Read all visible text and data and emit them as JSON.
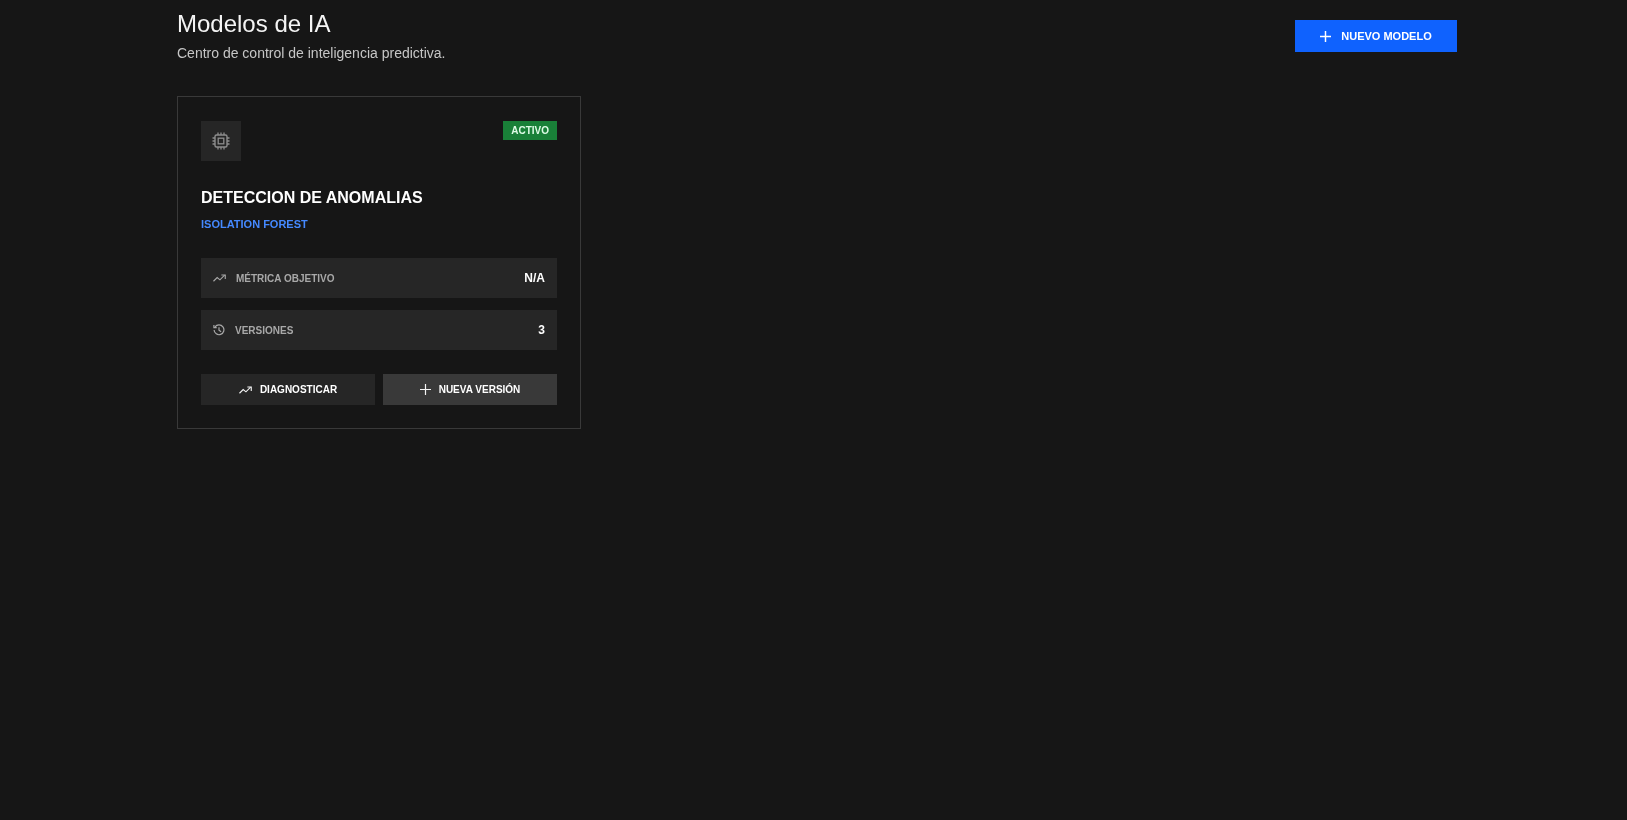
{
  "header": {
    "title": "Modelos de IA",
    "subtitle": "Centro de control de inteligencia predictiva.",
    "new_button": {
      "label": "NUEVO MODELO"
    }
  },
  "models": [
    {
      "title": "DETECCION DE ANOMALIAS",
      "algorithm": "ISOLATION FOREST",
      "status": {
        "label": "ACTIVO",
        "color": "#198038"
      },
      "metrics": [
        {
          "kind": "trend",
          "label": "MÉTRICA OBJETIVO",
          "value": "N/A"
        },
        {
          "kind": "history",
          "label": "VERSIONES",
          "value": "3"
        }
      ],
      "actions": [
        {
          "kind": "diagnose",
          "label": "DIAGNOSTICAR"
        },
        {
          "kind": "add",
          "label": "NUEVA VERSIÓN"
        }
      ]
    }
  ]
}
